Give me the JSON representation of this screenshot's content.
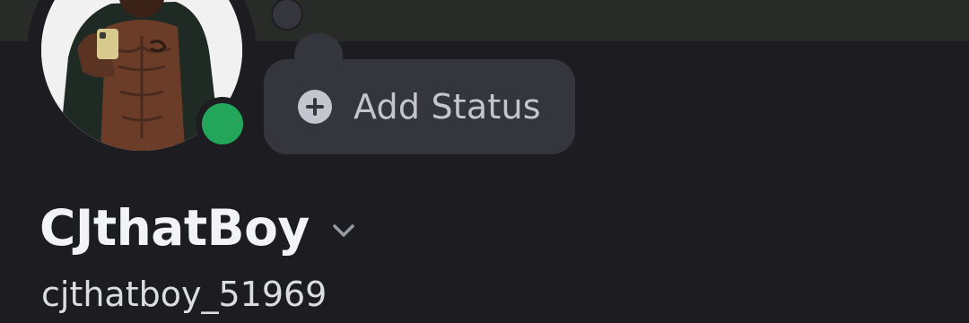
{
  "profile": {
    "display_name": "CJthatBoy",
    "username": "cjthatboy_51969",
    "presence": "online",
    "presence_color": "#23a55a"
  },
  "status_button": {
    "label": "Add Status",
    "icon": "plus-circle-icon"
  },
  "colors": {
    "background": "#1c1c21",
    "banner": "#292b29",
    "bubble": "#35363d"
  }
}
